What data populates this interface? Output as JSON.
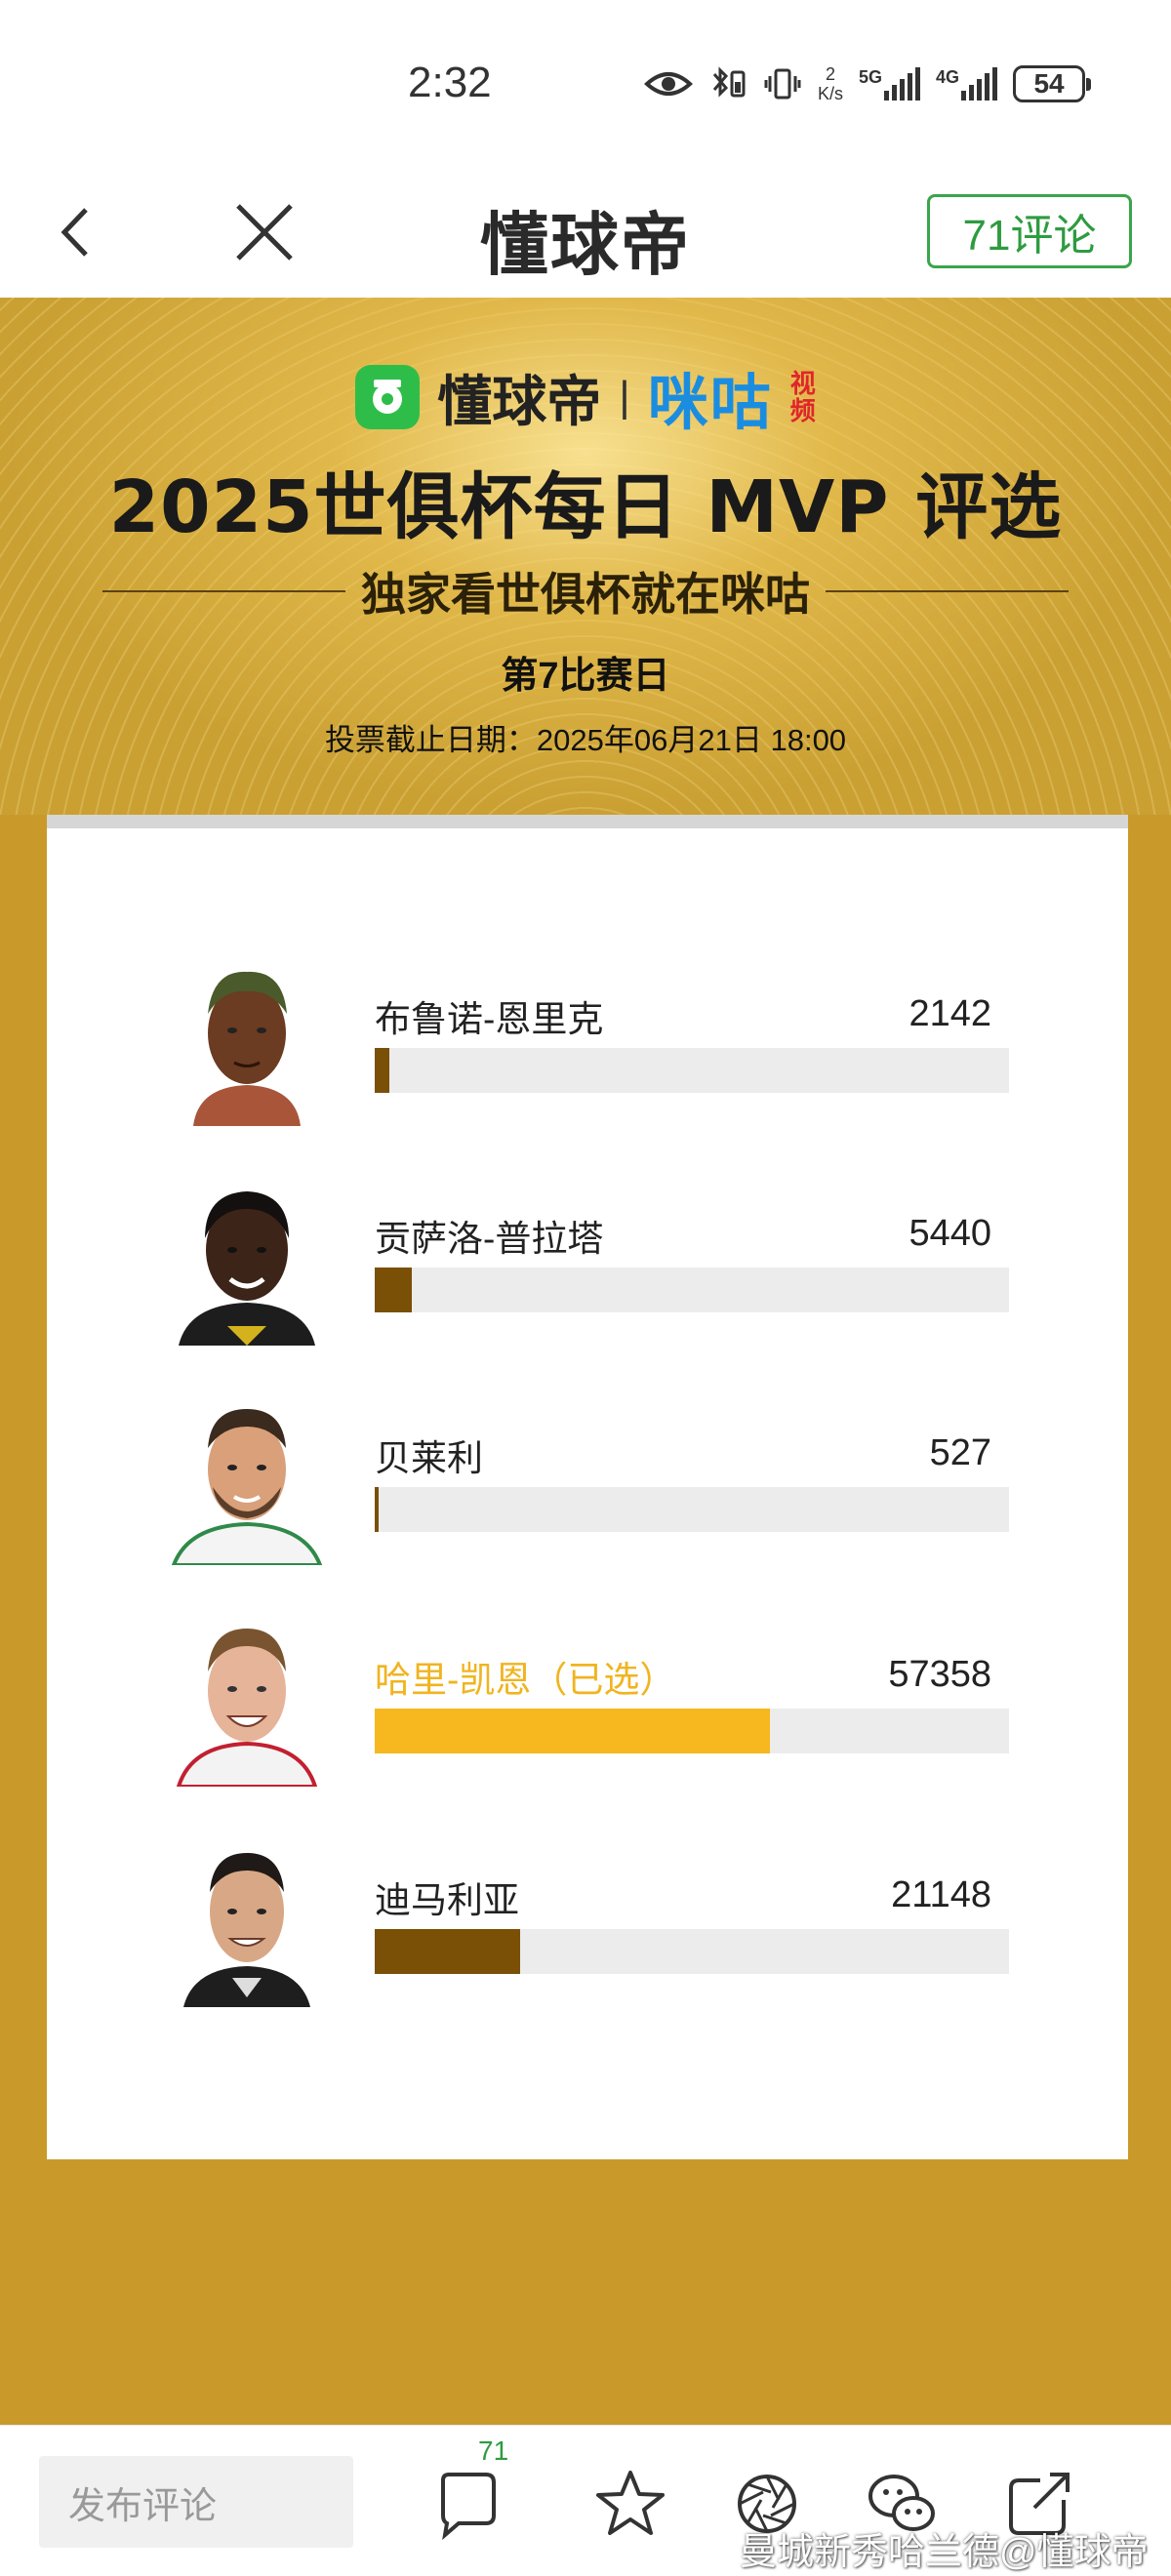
{
  "status_bar": {
    "time": "2:32",
    "net_speed_value": "2",
    "net_speed_unit": "K/s",
    "signal1_label": "5G",
    "signal2_label": "4G",
    "battery": "54"
  },
  "nav": {
    "title": "懂球帝",
    "comment_button": "71评论"
  },
  "banner": {
    "brand_left": "懂球帝",
    "brand_separator": "|",
    "brand_right": "咪咕",
    "brand_right_sub1": "视",
    "brand_right_sub2": "频",
    "title": "2025世俱杯每日 MVP 评选",
    "subtitle": "独家看世俱杯就在咪咕",
    "matchday": "第7比赛日",
    "deadline": "投票截止日期：2025年06月21日 18:00"
  },
  "vote": {
    "max_votes": 92000,
    "players": [
      {
        "name": "布鲁诺-恩里克",
        "votes": "2142",
        "count": 2142,
        "selected": false
      },
      {
        "name": "贡萨洛-普拉塔",
        "votes": "5440",
        "count": 5440,
        "selected": false
      },
      {
        "name": "贝莱利",
        "votes": "527",
        "count": 527,
        "selected": false
      },
      {
        "name": "哈里-凯恩（已选）",
        "votes": "57358",
        "count": 57358,
        "selected": true
      },
      {
        "name": "迪马利亚",
        "votes": "21148",
        "count": 21148,
        "selected": false
      }
    ]
  },
  "bottom_bar": {
    "comment_placeholder": "发布评论",
    "comment_count_badge": "71",
    "watermark": "曼城新秀哈兰德@懂球帝"
  },
  "colors": {
    "banner_gold": "#c99a2a",
    "bar_default": "#7a4f06",
    "bar_selected": "#f6b81e",
    "selected_text": "#f0b41f",
    "comment_green": "#2e9b3f",
    "migu_blue": "#1b8de0"
  },
  "icons": {
    "back": "chevron-left-icon",
    "close": "close-icon",
    "comments": "comment-bubble-icon",
    "favorite": "star-icon",
    "camera": "aperture-icon",
    "wechat": "wechat-icon",
    "share": "share-icon"
  }
}
